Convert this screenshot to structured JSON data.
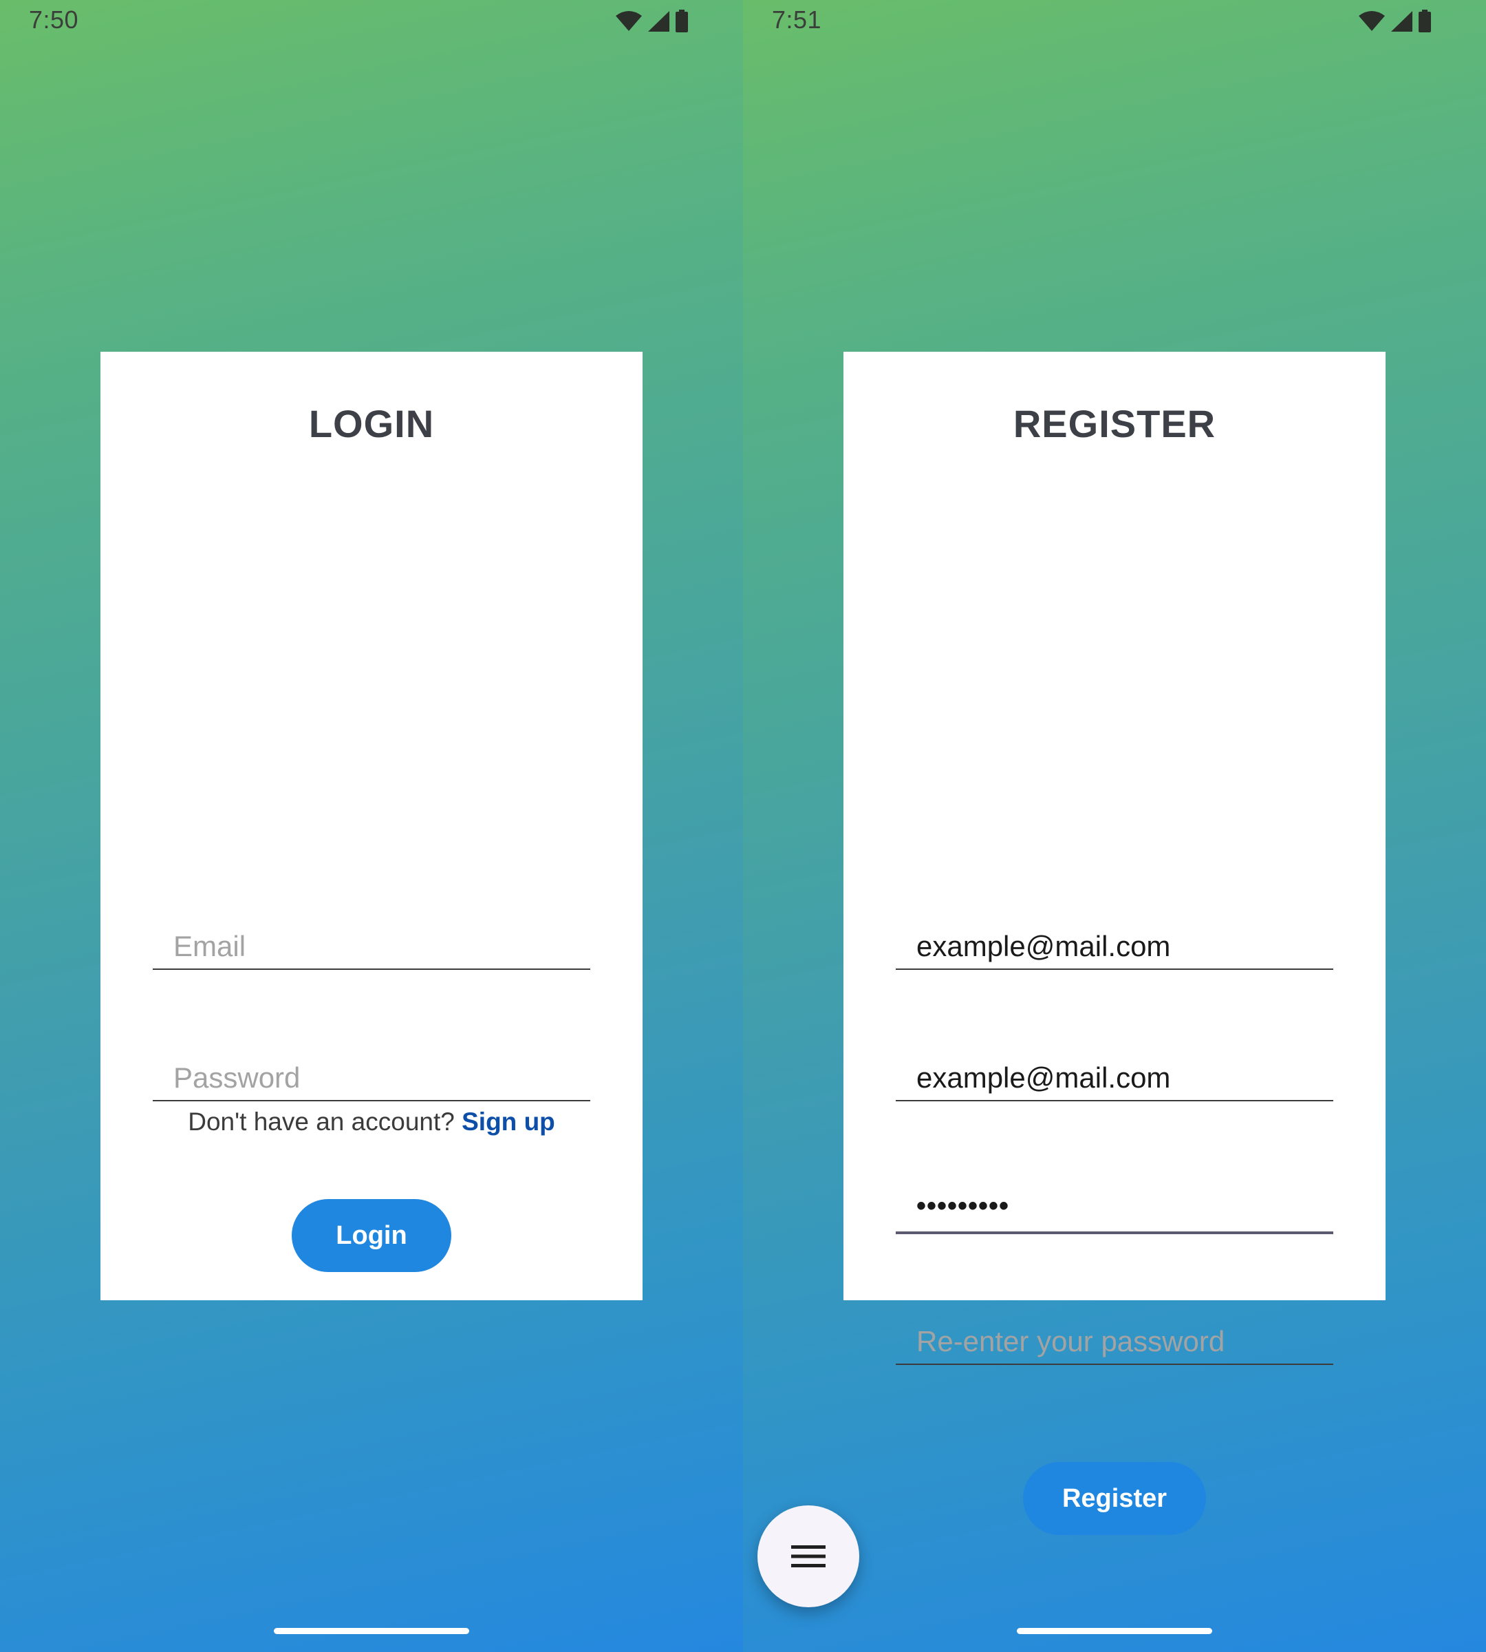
{
  "login_screen": {
    "status_time": "7:50",
    "title": "LOGIN",
    "email": {
      "value": "",
      "placeholder": "Email"
    },
    "password": {
      "value": "",
      "placeholder": "Password"
    },
    "login_button": "Login",
    "signup_prompt": "Don't have an account?",
    "signup_link": "Sign up"
  },
  "register_screen": {
    "status_time": "7:51",
    "title": "REGISTER",
    "fields": [
      {
        "value": "example@mail.com"
      },
      {
        "value": "example@mail.com"
      },
      {
        "value": "•••••••••"
      },
      {
        "value": "",
        "placeholder": "Re-enter your password"
      }
    ],
    "register_button": "Register",
    "menu_fab_icon": "menu-icon"
  },
  "status_icons": [
    "wifi-icon",
    "cellular-signal-icon",
    "battery-icon"
  ],
  "colors": {
    "gradient_top": "#69bd6a",
    "gradient_bottom": "#2588df",
    "button": "#1f87e0",
    "link": "#0d4fa8",
    "title": "#3d4047"
  }
}
